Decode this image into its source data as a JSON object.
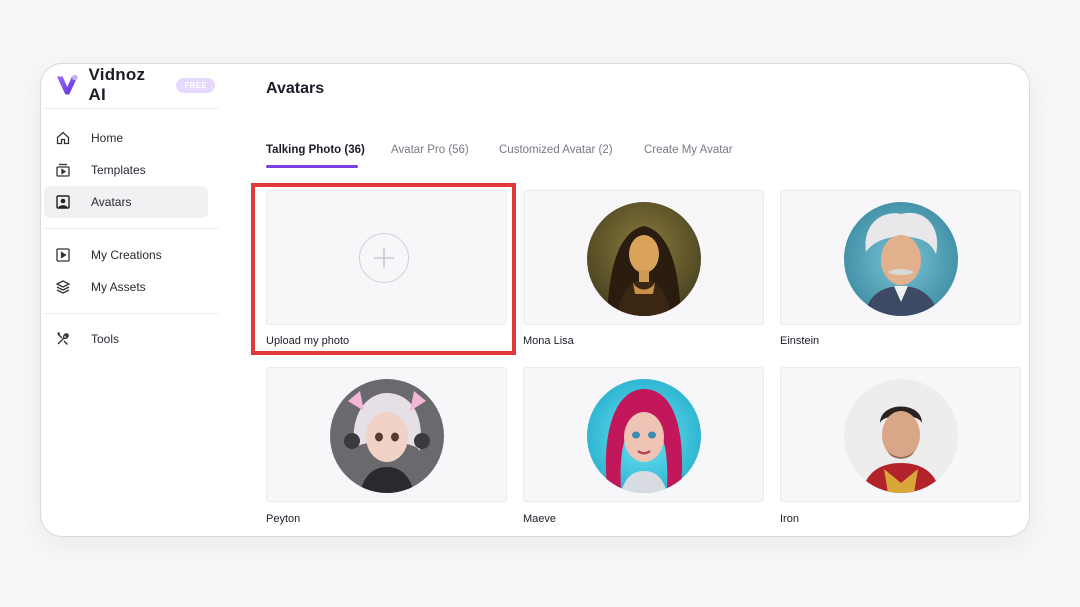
{
  "brand": {
    "name": "Vidnoz AI",
    "badge": "FREE",
    "accent": "#7b3fe4",
    "badge_color": "#e6d9ff"
  },
  "sidebar": {
    "group1": [
      {
        "label": "Home",
        "icon": "home-icon"
      },
      {
        "label": "Templates",
        "icon": "templates-icon"
      },
      {
        "label": "Avatars",
        "icon": "avatar-icon",
        "active": true
      }
    ],
    "group2": [
      {
        "label": "My Creations",
        "icon": "play-icon"
      },
      {
        "label": "My Assets",
        "icon": "layers-icon"
      }
    ],
    "group3": [
      {
        "label": "Tools",
        "icon": "tools-icon"
      }
    ]
  },
  "main": {
    "title": "Avatars",
    "tabs": [
      {
        "label": "Talking Photo (36)",
        "active": true
      },
      {
        "label": "Avatar Pro (56)"
      },
      {
        "label": "Customized Avatar (2)"
      },
      {
        "label": "Create My Avatar"
      }
    ],
    "cards": [
      {
        "label": "Upload my photo",
        "type": "upload",
        "highlighted": true
      },
      {
        "label": "Mona Lisa",
        "type": "avatar",
        "portrait": "mona-lisa-portrait"
      },
      {
        "label": "Einstein",
        "type": "avatar",
        "portrait": "einstein-portrait"
      },
      {
        "label": "Peyton",
        "type": "avatar",
        "portrait": "peyton-portrait"
      },
      {
        "label": "Maeve",
        "type": "avatar",
        "portrait": "maeve-portrait"
      },
      {
        "label": "Iron",
        "type": "avatar",
        "portrait": "iron-portrait"
      }
    ],
    "highlight_color": "#e2383a"
  }
}
